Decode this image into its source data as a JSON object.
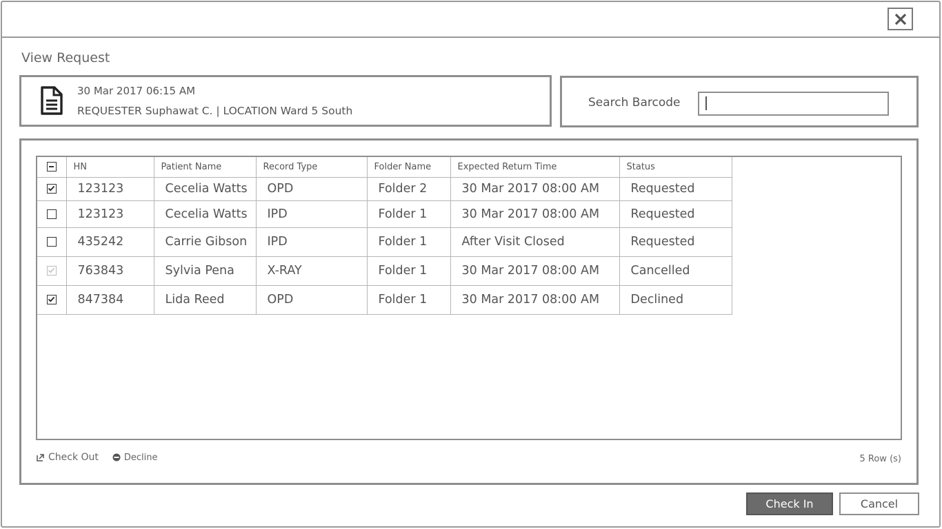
{
  "dialog": {
    "title": "View Request",
    "close_icon": "close-icon"
  },
  "request": {
    "datetime": "30 Mar 2017 06:15 AM",
    "details": "REQUESTER Suphawat C. | LOCATION  Ward 5 South",
    "icon": "document-icon"
  },
  "search": {
    "label": "Search Barcode",
    "value": "",
    "placeholder": ""
  },
  "table": {
    "columns": [
      "",
      "HN",
      "Patient Name",
      "Record Type",
      "Folder Name",
      "Expected Return Time",
      "Status"
    ],
    "header_checkbox": "indeterminate",
    "rows": [
      {
        "checked": true,
        "disabled": false,
        "hn": "123123",
        "patient": "Cecelia Watts",
        "record_type": "OPD",
        "folder": "Folder 2",
        "return_time": "30 Mar 2017 08:00 AM",
        "status": "Requested"
      },
      {
        "checked": false,
        "disabled": false,
        "hn": "123123",
        "patient": "Cecelia Watts",
        "record_type": "IPD",
        "folder": "Folder 1",
        "return_time": "30 Mar 2017 08:00 AM",
        "status": "Requested"
      },
      {
        "checked": false,
        "disabled": false,
        "hn": "435242",
        "patient": "Carrie Gibson",
        "record_type": "IPD",
        "folder": "Folder 1",
        "return_time": "After Visit Closed",
        "status": "Requested"
      },
      {
        "checked": true,
        "disabled": true,
        "hn": "763843",
        "patient": "Sylvia Pena",
        "record_type": "X-RAY",
        "folder": "Folder 1",
        "return_time": "30 Mar 2017 08:00 AM",
        "status": "Cancelled"
      },
      {
        "checked": true,
        "disabled": false,
        "hn": "847384",
        "patient": "Lida Reed",
        "record_type": "OPD",
        "folder": "Folder 1",
        "return_time": "30 Mar 2017 08:00 AM",
        "status": "Declined"
      }
    ]
  },
  "actions": {
    "check_out": "Check Out",
    "decline": "Decline"
  },
  "footer": {
    "row_count": "5 Row (s)",
    "check_in_label": "Check In",
    "cancel_label": "Cancel"
  },
  "colors": {
    "border": "#8e8e8e",
    "primary_button": "#6b6b6b",
    "text": "#555555"
  }
}
